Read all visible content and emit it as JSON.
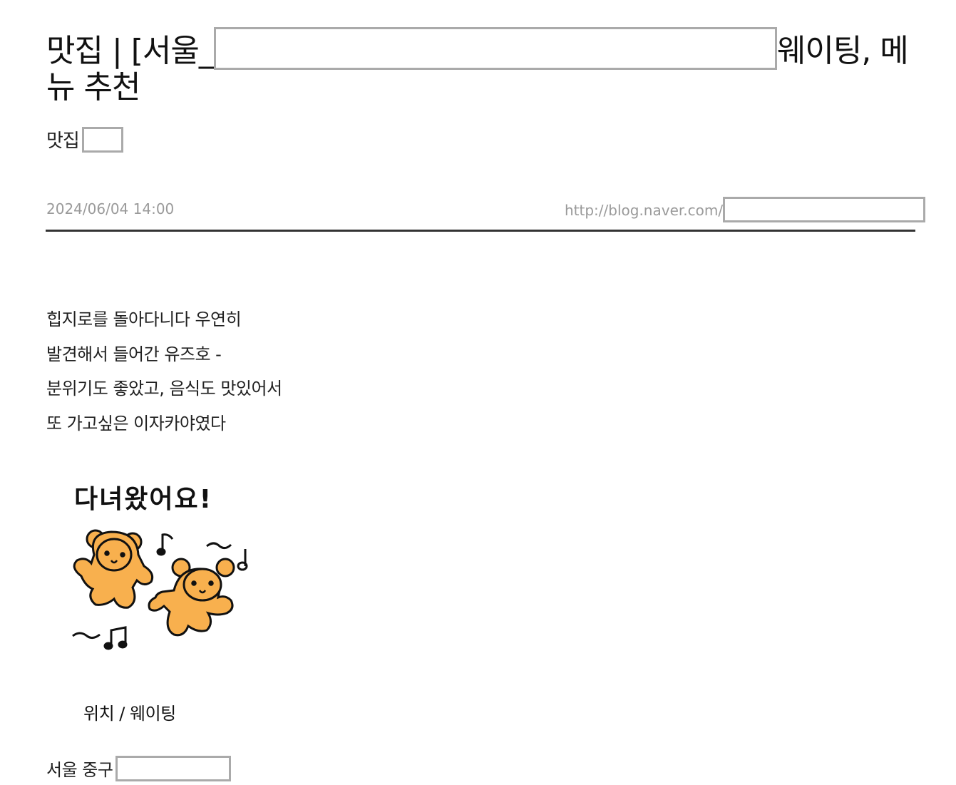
{
  "post": {
    "title_start": "맛집 | [서울_",
    "title_end": "웨이팅, 메뉴 추천",
    "category": "맛집",
    "date": "2024/06/04 14:00",
    "url_prefix": "http://blog.naver.com/"
  },
  "body": {
    "lines": [
      "힙지로를 돌아다니다 우연히",
      "발견해서 들어간 유즈호 -",
      "분위기도 좋았고, 음식도 맛있어서",
      "또 가고싶은 이자카야였다"
    ],
    "sticker_caption": "다녀왔어요!",
    "sticker_colors": {
      "bear": "#f8b04e",
      "outline": "#111111"
    }
  },
  "section": {
    "heading": "위치 / 웨이팅",
    "address_prefix": "서울 중구"
  },
  "colors": {
    "text": "#222222",
    "meta": "#9a9a9a",
    "divider": "#333333",
    "redaction_border": "#aaaaaa"
  }
}
